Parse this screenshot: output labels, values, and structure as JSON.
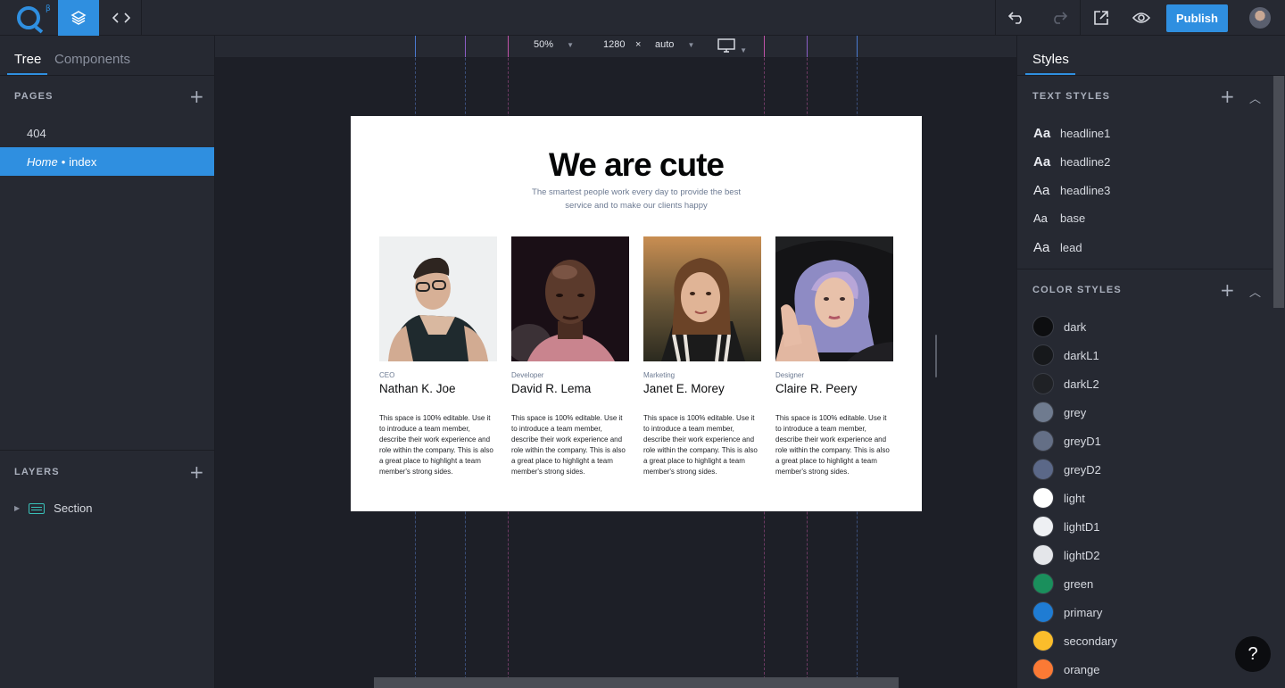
{
  "topbar": {
    "logo_beta": "β",
    "publish_label": "Publish",
    "icons": [
      "layers-icon",
      "code-icon",
      "undo-icon",
      "redo-icon",
      "external-link-icon",
      "preview-eye-icon"
    ]
  },
  "left_panel": {
    "tabs": [
      "Tree",
      "Components"
    ],
    "pages_heading": "PAGES",
    "pages": [
      {
        "label": "404"
      },
      {
        "home_label": "Home",
        "separator": "•",
        "label": "index",
        "selected": true
      }
    ],
    "layers_heading": "LAYERS",
    "layers": [
      {
        "label": "Section"
      }
    ]
  },
  "canvas": {
    "zoom": "50%",
    "width": "1280",
    "times": "×",
    "height": "auto",
    "device": "desktop-icon"
  },
  "page": {
    "title": "We are cute",
    "subtitle": "The smartest people work every day to provide the best service and to make our clients happy",
    "members": [
      {
        "role": "CEO",
        "name": "Nathan K. Joe",
        "bio": "This space is 100% editable. Use it to introduce a team member, describe their work experience and role within the company. This is also a great place to highlight a team member's strong sides."
      },
      {
        "role": "Developer",
        "name": "David R. Lema",
        "bio": "This space is 100% editable. Use it to introduce a team member, describe their work experience and role within the company. This is also a great place to highlight a team member's strong sides."
      },
      {
        "role": "Marketing",
        "name": "Janet E. Morey",
        "bio": "This space is 100% editable. Use it to introduce a team member, describe their work experience and role within the company. This is also a great place to highlight a team member's strong sides."
      },
      {
        "role": "Designer",
        "name": "Claire R. Peery",
        "bio": "This space is 100% editable. Use it to introduce a team member, describe their work experience and role within the company. This is also a great place to highlight a team member's strong sides."
      }
    ]
  },
  "right_panel": {
    "tab": "Styles",
    "text_styles_heading": "TEXT STYLES",
    "text_styles": [
      {
        "preview": "Aa",
        "label": "headline1",
        "bold": true
      },
      {
        "preview": "Aa",
        "label": "headline2",
        "bold": true
      },
      {
        "preview": "Aa",
        "label": "headline3",
        "bold": false
      },
      {
        "preview": "Aa",
        "label": "base",
        "bold": false
      },
      {
        "preview": "Aa",
        "label": "lead",
        "bold": false
      }
    ],
    "color_styles_heading": "COLOR STYLES",
    "color_styles": [
      {
        "label": "dark",
        "color": "#0d0e10"
      },
      {
        "label": "darkL1",
        "color": "#16181b"
      },
      {
        "label": "darkL2",
        "color": "#1f2125"
      },
      {
        "label": "grey",
        "color": "#6f7b8f"
      },
      {
        "label": "greyD1",
        "color": "#646f86"
      },
      {
        "label": "greyD2",
        "color": "#5b6888"
      },
      {
        "label": "light",
        "color": "#ffffff"
      },
      {
        "label": "lightD1",
        "color": "#eef0f3"
      },
      {
        "label": "lightD2",
        "color": "#e4e6ea"
      },
      {
        "label": "green",
        "color": "#1a8f5c"
      },
      {
        "label": "primary",
        "color": "#1f7cd3"
      },
      {
        "label": "secondary",
        "color": "#fbbd2b"
      },
      {
        "label": "orange",
        "color": "#fb7a35"
      }
    ]
  },
  "help_label": "?"
}
